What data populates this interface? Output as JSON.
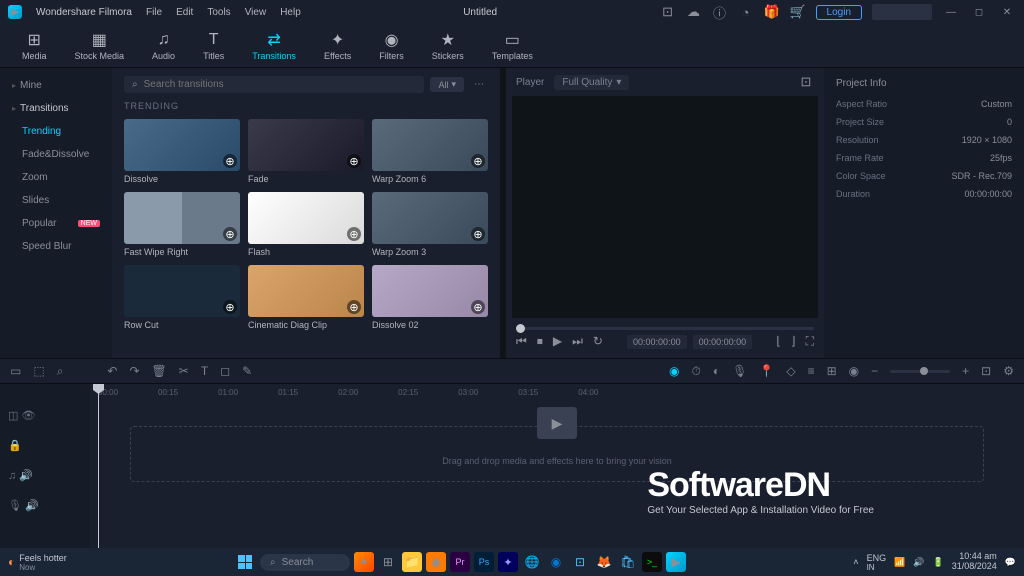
{
  "app": {
    "name": "Wondershare Filmora",
    "title": "Untitled"
  },
  "menu": [
    "File",
    "Edit",
    "Tools",
    "View",
    "Help"
  ],
  "titlebar": {
    "login": "Login"
  },
  "tools": [
    {
      "icon": "⊞",
      "label": "Media"
    },
    {
      "icon": "▦",
      "label": "Stock Media"
    },
    {
      "icon": "♫",
      "label": "Audio"
    },
    {
      "icon": "T",
      "label": "Titles"
    },
    {
      "icon": "⇄",
      "label": "Transitions"
    },
    {
      "icon": "✦",
      "label": "Effects"
    },
    {
      "icon": "◉",
      "label": "Filters"
    },
    {
      "icon": "★",
      "label": "Stickers"
    },
    {
      "icon": "▭",
      "label": "Templates"
    }
  ],
  "sidebar": {
    "mine": "Mine",
    "transitions": "Transitions",
    "items": [
      "Trending",
      "Fade&Dissolve",
      "Zoom",
      "Slides",
      "Popular",
      "Speed Blur"
    ]
  },
  "browser": {
    "search_placeholder": "Search transitions",
    "all": "All",
    "section": "TRENDING",
    "items": [
      {
        "label": "Dissolve"
      },
      {
        "label": "Fade"
      },
      {
        "label": "Warp Zoom 6"
      },
      {
        "label": "Fast Wipe Right"
      },
      {
        "label": "Flash"
      },
      {
        "label": "Warp Zoom 3"
      },
      {
        "label": "Row Cut"
      },
      {
        "label": "Cinematic Diag Clip"
      },
      {
        "label": "Dissolve 02"
      }
    ]
  },
  "preview": {
    "player_tab": "Player",
    "quality": "Full Quality",
    "time_cur": "00:00:00:00",
    "time_dur": "00:00:00:00"
  },
  "props": {
    "title": "Project Info",
    "rows": [
      {
        "k": "Aspect Ratio",
        "v": "Custom"
      },
      {
        "k": "Project Size",
        "v": "0"
      },
      {
        "k": "Resolution",
        "v": "1920 × 1080"
      },
      {
        "k": "Frame Rate",
        "v": "25fps"
      },
      {
        "k": "Color Space",
        "v": "SDR - Rec.709"
      },
      {
        "k": "Duration",
        "v": "00:00:00:00"
      }
    ]
  },
  "timeline": {
    "ruler": [
      "00:00",
      "00:15",
      "01:00",
      "01:15",
      "02:00",
      "02:15",
      "03:00",
      "03:15",
      "04:00"
    ],
    "dropzone": "Drag and drop media and effects here to bring your vision"
  },
  "watermark": {
    "title": "SoftwareDN",
    "sub": "Get Your Selected App & Installation Video for Free"
  },
  "taskbar": {
    "weather": {
      "cond": "Feels hotter",
      "sub": "Now"
    },
    "search": "Search",
    "lang": "ENG",
    "region": "IN",
    "time": "10:44 am",
    "date": "31/08/2024"
  }
}
